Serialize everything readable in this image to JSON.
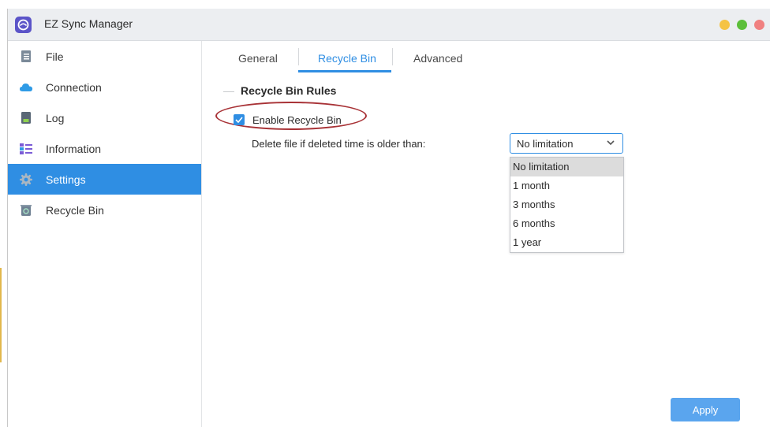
{
  "window": {
    "title": "EZ Sync Manager",
    "controls": [
      "minimize",
      "maximize",
      "close"
    ]
  },
  "colors": {
    "accent": "#2f8ee3",
    "minimize": "#f5c344",
    "maximize": "#5cbf3a",
    "close": "#f08080"
  },
  "sidebar": {
    "items": [
      {
        "label": "File",
        "icon": "file-icon",
        "active": false
      },
      {
        "label": "Connection",
        "icon": "cloud-icon",
        "active": false
      },
      {
        "label": "Log",
        "icon": "log-icon",
        "active": false
      },
      {
        "label": "Information",
        "icon": "list-icon",
        "active": false
      },
      {
        "label": "Settings",
        "icon": "gear-icon",
        "active": true
      },
      {
        "label": "Recycle Bin",
        "icon": "recycle-bin-icon",
        "active": false
      }
    ]
  },
  "tabs": [
    {
      "label": "General",
      "active": false
    },
    {
      "label": "Recycle Bin",
      "active": true
    },
    {
      "label": "Advanced",
      "active": false
    }
  ],
  "section": {
    "title": "Recycle Bin Rules",
    "enable_label": "Enable Recycle Bin",
    "enable_checked": true,
    "delete_label": "Delete file if deleted time is older than:",
    "select_value": "No limitation",
    "options": [
      "No limitation",
      "1 month",
      "3 months",
      "6 months",
      "1 year"
    ]
  },
  "footer": {
    "apply_label": "Apply"
  }
}
